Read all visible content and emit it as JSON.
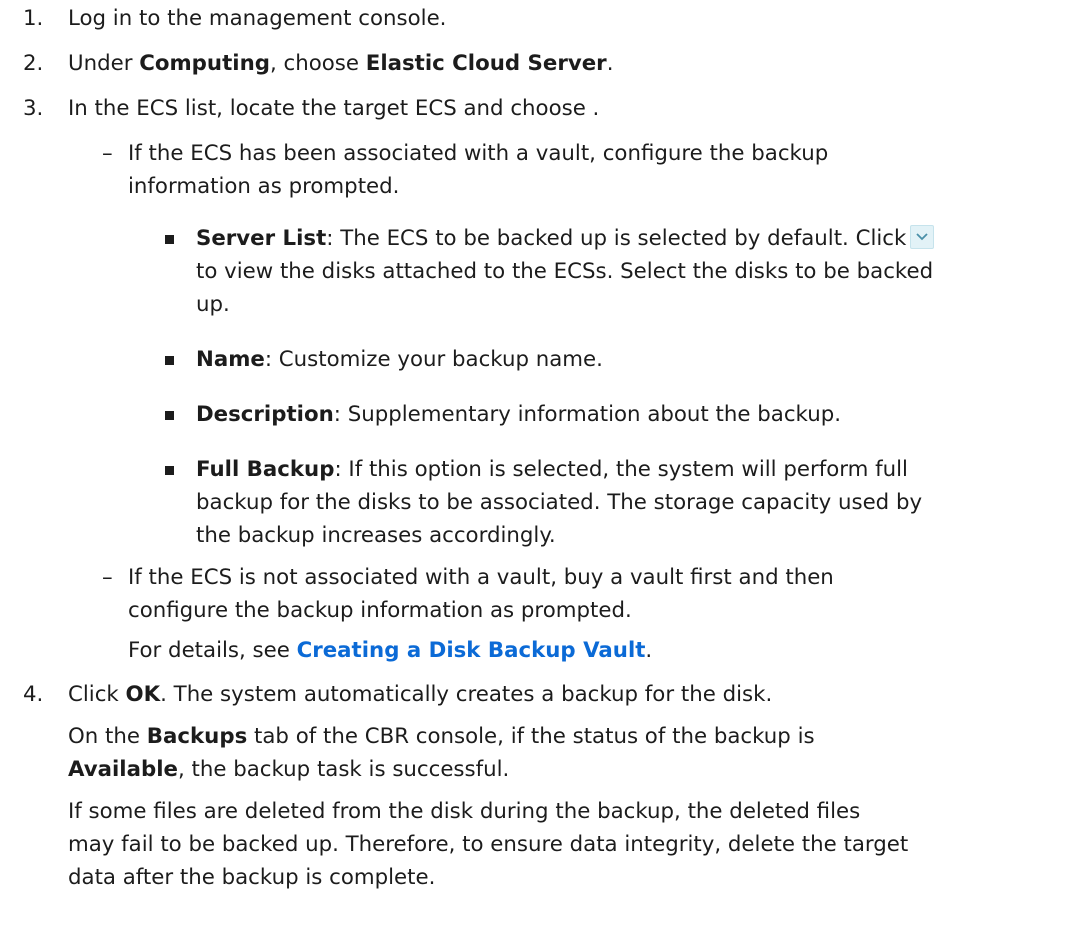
{
  "steps": [
    {
      "num": "1.",
      "text": "Log in to the management console."
    },
    {
      "num": "2.",
      "pre": "Under ",
      "b1": "Computing",
      "mid": ", choose ",
      "b2": "Elastic Cloud Server",
      "post": "."
    },
    {
      "num": "3.",
      "text": "In the ECS list, locate the target ECS and choose ."
    },
    {
      "num": "4.",
      "pre": "Click ",
      "b1": "OK",
      "post": ". The system automatically creates a backup for the disk."
    }
  ],
  "case_a": {
    "dash": "–",
    "line1": "If the ECS has been associated with a vault, configure the backup",
    "line2": "information as prompted."
  },
  "fields": {
    "server_list": {
      "label": "Server List",
      "line1": ": The ECS to be backed up is selected by default. Click",
      "line2": "to view the disks attached to the ECSs. Select the disks to be backed",
      "line3": "up."
    },
    "name": {
      "label": "Name",
      "text": ": Customize your backup name."
    },
    "description": {
      "label": "Description",
      "text": ": Supplementary information about the backup."
    },
    "full_backup": {
      "label": "Full Backup",
      "line1": ": If this option is selected, the system will perform full",
      "line2": "backup for the disks to be associated. The storage capacity used by",
      "line3": "the backup increases accordingly."
    }
  },
  "case_b": {
    "dash": "–",
    "line1": "If the ECS is not associated with a vault, buy a vault first and then",
    "line2": "configure the backup information as prompted.",
    "details_pre": "For details, see ",
    "details_link": "Creating a Disk Backup Vault",
    "details_post": "."
  },
  "after": {
    "p1_pre": "On the ",
    "p1_b1": "Backups",
    "p1_mid": " tab of the CBR console, if the status of the backup is",
    "p1_b2": "Available",
    "p1_post": ", the backup task is successful.",
    "p2_line1": "If some files are deleted from the disk during the backup, the deleted files",
    "p2_line2": "may fail to be backed up. Therefore, to ensure data integrity, delete the target",
    "p2_line3": "data after the backup is complete."
  },
  "icons": {
    "expand": "chevron-down-icon"
  },
  "colors": {
    "text": "#1c1c1c",
    "link": "#0b6ad6",
    "expand_bg": "#e2f2f7"
  }
}
